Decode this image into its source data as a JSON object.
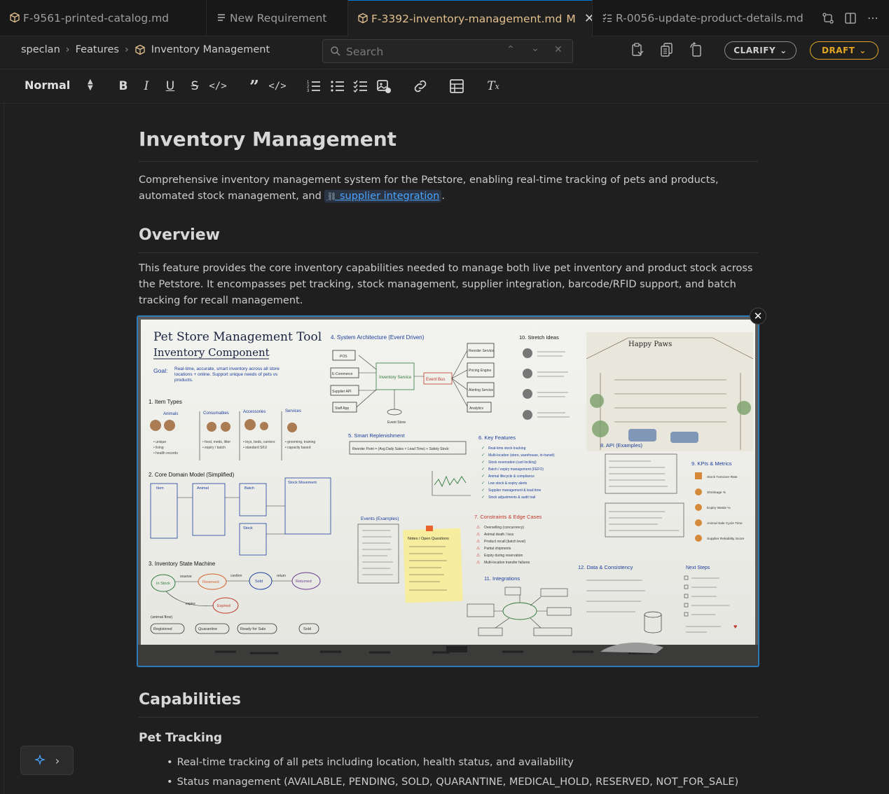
{
  "tabs": [
    {
      "label": "F-9561-printed-catalog.md",
      "icon": "box-icon",
      "active": false
    },
    {
      "label": "New Requirement",
      "icon": "list-icon",
      "active": false
    },
    {
      "label": "F-3392-inventory-management.md",
      "icon": "box-icon",
      "active": true,
      "modified": "M"
    },
    {
      "label": "R-0056-update-product-details.md",
      "icon": "checklist-icon",
      "active": false
    }
  ],
  "breadcrumb": {
    "root": "speclan",
    "section": "Features",
    "current": "Inventory Management",
    "sep": "›"
  },
  "search": {
    "placeholder": "Search"
  },
  "status": {
    "clarify": "CLARIFY",
    "draft": "DRAFT",
    "draft_color": "#e0a526"
  },
  "toolbar": {
    "block_style": "Normal"
  },
  "doc": {
    "title": "Inventory Management",
    "intro_before": "Comprehensive inventory management system for the Petstore, enabling real-time tracking of pets and products, automated stock management, and",
    "intro_link": "supplier integration",
    "intro_after": ".",
    "overview_heading": "Overview",
    "overview_text": "This feature provides the core inventory capabilities needed to manage both live pet inventory and product stock across the Petstore. It encompasses pet tracking, stock management, supplier integration, barcode/RFID support, and batch tracking for recall management.",
    "capabilities_heading": "Capabilities",
    "pet_tracking_heading": "Pet Tracking",
    "bullets": [
      "Real-time tracking of all pets including location, health status, and availability",
      "Status management (AVAILABLE, PENDING, SOLD, QUARANTINE, MEDICAL_HOLD, RESERVED, NOT_FOR_SALE)"
    ]
  },
  "whiteboard": {
    "title1": "Pet Store Management Tool",
    "title2": "Inventory Component",
    "goal_label": "Goal:",
    "goal": "Real-time, accurate, smart inventory across all store locations + online. Support unique needs of pets vs products.",
    "s1": "1. Item Types",
    "item_types": [
      "Animals",
      "Consumables",
      "Accessories",
      "Services"
    ],
    "s2": "2. Core Domain Model (Simplified)",
    "domain_boxes": [
      "Item",
      "Animal",
      "Batch",
      "Stock Movement",
      "Stock"
    ],
    "s3": "3. Inventory State Machine",
    "states": [
      "In Stock",
      "Reserved",
      "Sold",
      "Returned",
      "Expired"
    ],
    "state_transitions": [
      "reserve",
      "confirm",
      "return",
      "expire"
    ],
    "animal_flow_label": "(animal flow)",
    "animal_flow": [
      "Registered",
      "Quarantine",
      "Ready for Sale",
      "Sold"
    ],
    "s4": "4. System Architecture (Event Driven)",
    "arch_sources": [
      "POS",
      "E-Commerce",
      "Supplier API",
      "Staff App"
    ],
    "arch_core": "Inventory Service",
    "arch_bus": "Event Bus",
    "arch_targets": [
      "Reorder Service",
      "Pricing Engine",
      "Alerting Service",
      "Analytics"
    ],
    "arch_store": "Event Store",
    "s5": "5. Smart Replenishment",
    "reorder_formula": "Reorder Point = (Avg Daily Sales × Lead Time) + Safety Stock",
    "s6": "6. Key Features",
    "features": [
      "Real-time stock tracking",
      "Multi-location (store, warehouse, in-transit)",
      "Stock reservation (cart locking)",
      "Batch / expiry management (FEFO)",
      "Animal lifecycle & compliance",
      "Low stock & expiry alerts",
      "Supplier management & lead time",
      "Stock adjustments & audit trail"
    ],
    "s7": "7. Constraints & Edge Cases",
    "constraints": [
      "Overselling (concurrency)",
      "Animal death / loss",
      "Product recall (batch level)",
      "Partial shipments",
      "Expiry during reservation",
      "Multi-location transfer failures"
    ],
    "s8": "8. API (Examples)",
    "s9": "9. KPIs & Metrics",
    "kpis": [
      "Stock Turnover Rate",
      "Shrinkage %",
      "Expiry Waste %",
      "Animal Sale Cycle Time",
      "Supplier Reliability Score"
    ],
    "s10": "10. Stretch Ideas",
    "s11": "11. Integrations",
    "s12": "12. Data & Consistency",
    "events_label": "Events (Examples)",
    "notes_label": "Notes / Open Questions",
    "next_steps_label": "Next Steps",
    "store_sign": "Happy Paws"
  }
}
